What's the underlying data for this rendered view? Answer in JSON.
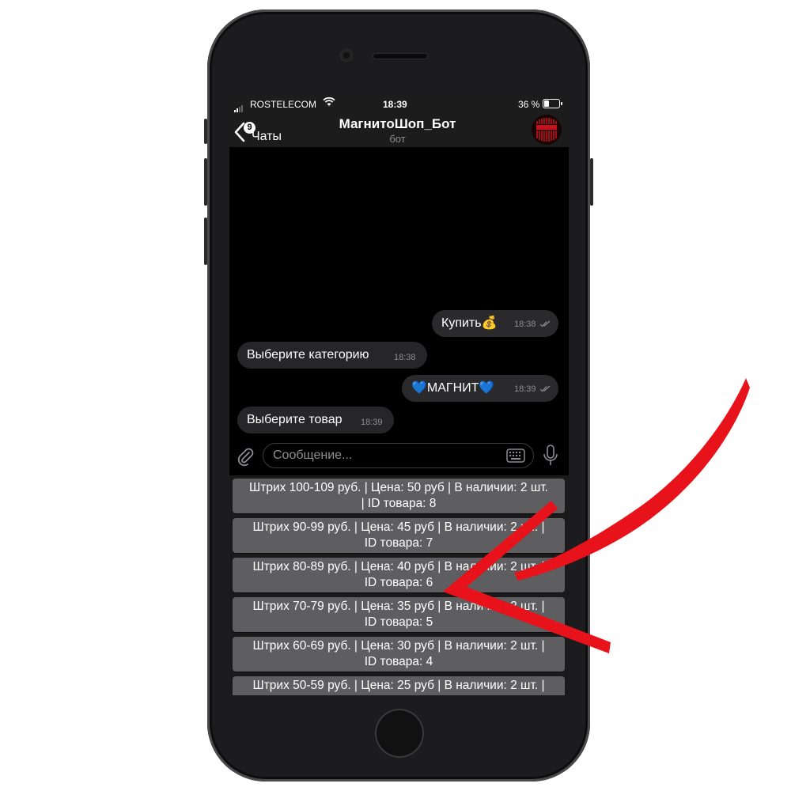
{
  "status_bar": {
    "carrier": "ROSTELECOM",
    "time": "18:39",
    "battery": "36 %",
    "battery_level": 0.36
  },
  "header": {
    "back_label": "Чаты",
    "unread_count": "9",
    "title": "МагнитоШоп_Бот",
    "subtitle": "бот",
    "avatar_icon": "magnit-logo-icon"
  },
  "messages": [
    {
      "direction": "outgoing",
      "text": "Купить💰",
      "time": "18:38",
      "read": true
    },
    {
      "direction": "incoming",
      "text": "Выберите категорию",
      "time": "18:38"
    },
    {
      "direction": "outgoing",
      "text": "💙МАГНИТ💙",
      "time": "18:39",
      "read": true
    },
    {
      "direction": "incoming",
      "text": "Выберите товар",
      "time": "18:39"
    }
  ],
  "composer": {
    "placeholder": "Сообщение...",
    "attach_icon": "paperclip-icon",
    "keyboard_icon": "keyboard-icon",
    "mic_icon": "microphone-icon"
  },
  "bot_keyboard": [
    {
      "line1": "Штрих 100-109 руб. | Цена: 50 руб | В наличии: 2 шт.",
      "line2": "| ID  товара: 8"
    },
    {
      "line1": "Штрих 90-99 руб. | Цена: 45 руб | В наличии: 2 шт. |",
      "line2": "ID  товара: 7"
    },
    {
      "line1": "Штрих 80-89 руб. | Цена: 40 руб | В наличии: 2 шт. |",
      "line2": "ID  товара: 6"
    },
    {
      "line1": "Штрих 70-79 руб. | Цена: 35 руб | В наличии: 2 шт. |",
      "line2": "ID  товара: 5"
    },
    {
      "line1": "Штрих 60-69 руб. | Цена: 30 руб | В наличии: 2 шт. |",
      "line2": "ID  товара: 4"
    },
    {
      "line1": "Штрих 50-59 руб. | Цена: 25 руб | В наличии: 2 шт. |",
      "line2": ""
    }
  ],
  "colors": {
    "annotation_arrow": "#e8121b",
    "keyboard_button": "#5e5e60"
  }
}
